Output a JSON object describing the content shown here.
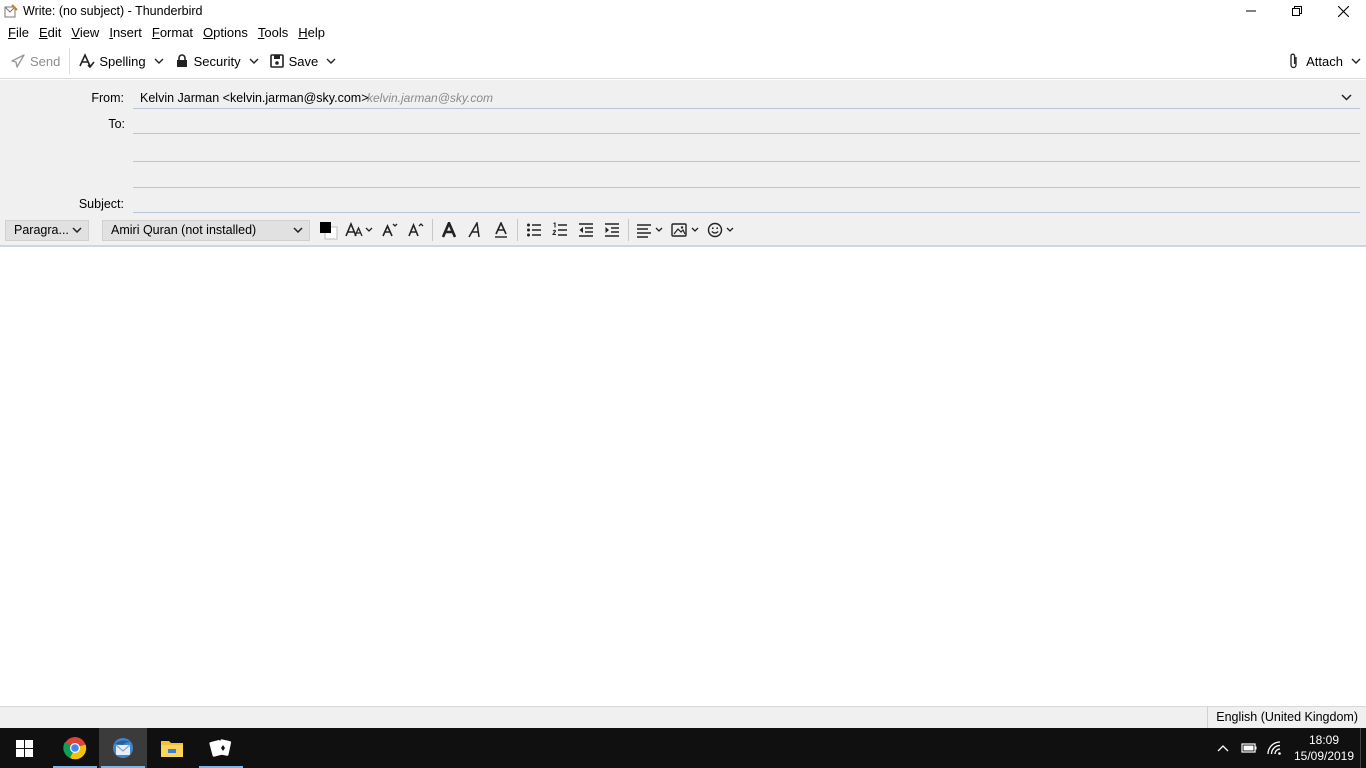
{
  "window": {
    "title": "Write: (no subject) - Thunderbird"
  },
  "menu": [
    "File",
    "Edit",
    "View",
    "Insert",
    "Format",
    "Options",
    "Tools",
    "Help"
  ],
  "toolbar": {
    "send": "Send",
    "spelling": "Spelling",
    "security": "Security",
    "save": "Save",
    "attach": "Attach"
  },
  "header": {
    "from_label": "From:",
    "from_value": "Kelvin Jarman <kelvin.jarman@sky.com>",
    "from_identity": "kelvin.jarman@sky.com",
    "to_label": "To:",
    "subject_label": "Subject:"
  },
  "format": {
    "paragraph": "Paragra...",
    "font": "Amiri Quran (not installed)"
  },
  "status": {
    "language": "English (United Kingdom)"
  },
  "taskbar": {
    "apps": [
      "chrome-icon",
      "thunderbird-icon",
      "file-explorer-icon",
      "solitaire-icon"
    ],
    "time": "18:09",
    "date": "15/09/2019"
  },
  "colors": {
    "header_bg": "#f0f0f0",
    "taskbar_bg": "#101010",
    "field_line": "#b8c5d6"
  }
}
